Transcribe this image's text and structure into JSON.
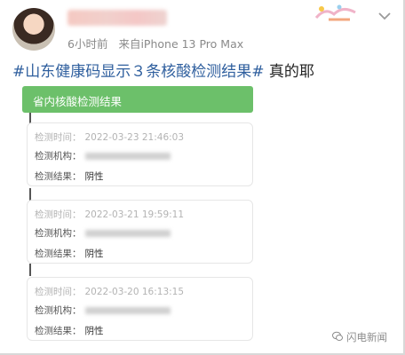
{
  "post": {
    "time": "6小时前",
    "source": "来自iPhone 13 Pro Max",
    "hashtag": "#山东健康码显示３条核酸检测结果#",
    "comment": " 真的耶"
  },
  "card": {
    "title": "省内核酸检测结果",
    "labels": {
      "time": "检测时间：",
      "org": "检测机构：",
      "result": "检测结果："
    },
    "records": [
      {
        "time": "2022-03-23 21:46:03",
        "result": "阴性"
      },
      {
        "time": "2022-03-21 19:59:11",
        "result": "阴性"
      },
      {
        "time": "2022-03-20 16:13:15",
        "result": "阴性"
      }
    ]
  },
  "watermark": {
    "text": "闪电新闻",
    "icon": "wechat-icon"
  },
  "icons": {
    "menu": "chevron-down-icon",
    "decoration": "sticker-decoration"
  },
  "colors": {
    "accent_green": "#6cc06a",
    "hashtag_blue": "#2f5f9e",
    "meta_gray": "#8a8a8a"
  }
}
